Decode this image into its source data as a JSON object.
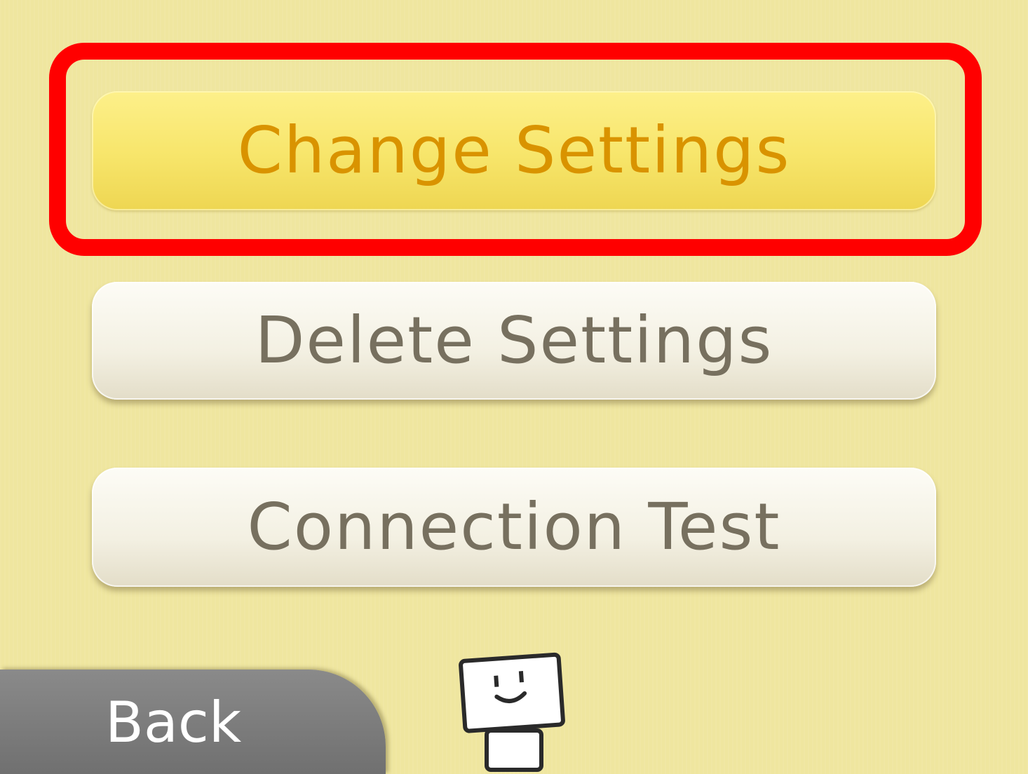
{
  "menu": {
    "items": [
      {
        "label": "Change Settings",
        "state": "highlighted"
      },
      {
        "label": "Delete Settings",
        "state": "normal"
      },
      {
        "label": "Connection Test",
        "state": "normal"
      }
    ]
  },
  "footer": {
    "back_label": "Back"
  },
  "mascot": {
    "icon": "smiling-block-mascot-icon"
  },
  "colors": {
    "background": "#efe69f",
    "highlight_frame": "#ff0000",
    "selected_button": "#f7e56a",
    "selected_text": "#d99300",
    "normal_text": "#77705f",
    "back_button": "#707070"
  }
}
